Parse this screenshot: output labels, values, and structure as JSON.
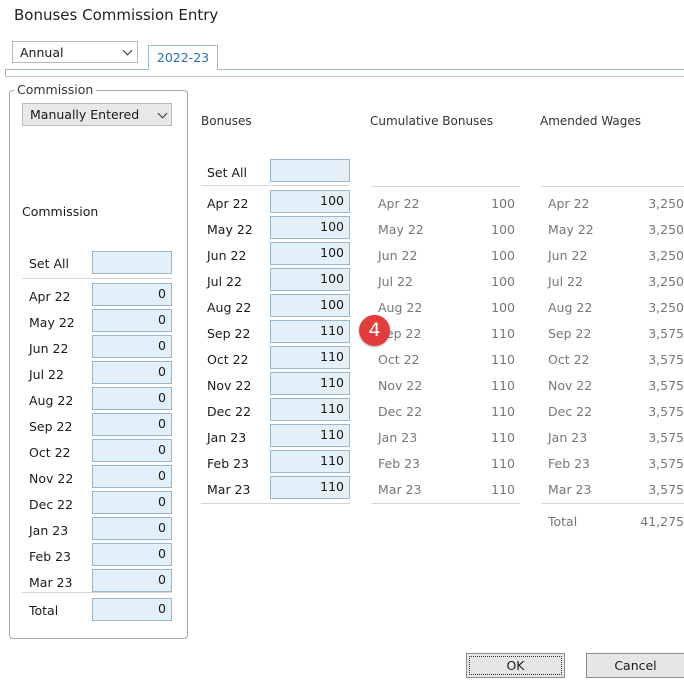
{
  "window": {
    "title": "Bonuses Commission Entry"
  },
  "period_select": {
    "value": "Annual"
  },
  "tab": {
    "label": "2022-23"
  },
  "commission": {
    "group_label": "Commission",
    "mode_select": "Manually Entered",
    "heading": "Commission",
    "set_all_label": "Set All",
    "set_all_value": "",
    "rows": [
      {
        "month": "Apr 22",
        "value": "0"
      },
      {
        "month": "May 22",
        "value": "0"
      },
      {
        "month": "Jun 22",
        "value": "0"
      },
      {
        "month": "Jul 22",
        "value": "0"
      },
      {
        "month": "Aug 22",
        "value": "0"
      },
      {
        "month": "Sep 22",
        "value": "0"
      },
      {
        "month": "Oct 22",
        "value": "0"
      },
      {
        "month": "Nov 22",
        "value": "0"
      },
      {
        "month": "Dec 22",
        "value": "0"
      },
      {
        "month": "Jan 23",
        "value": "0"
      },
      {
        "month": "Feb 23",
        "value": "0"
      },
      {
        "month": "Mar 23",
        "value": "0"
      }
    ],
    "total_label": "Total",
    "total_value": "0"
  },
  "bonuses": {
    "heading": "Bonuses",
    "set_all_label": "Set All",
    "set_all_value": "",
    "rows": [
      {
        "month": "Apr 22",
        "value": "100"
      },
      {
        "month": "May 22",
        "value": "100"
      },
      {
        "month": "Jun 22",
        "value": "100"
      },
      {
        "month": "Jul 22",
        "value": "100"
      },
      {
        "month": "Aug 22",
        "value": "100"
      },
      {
        "month": "Sep 22",
        "value": "110"
      },
      {
        "month": "Oct 22",
        "value": "110"
      },
      {
        "month": "Nov 22",
        "value": "110"
      },
      {
        "month": "Dec 22",
        "value": "110"
      },
      {
        "month": "Jan 23",
        "value": "110"
      },
      {
        "month": "Feb 23",
        "value": "110"
      },
      {
        "month": "Mar 23",
        "value": "110"
      }
    ]
  },
  "cumulative": {
    "heading": "Cumulative Bonuses",
    "rows": [
      {
        "month": "Apr 22",
        "value": "100"
      },
      {
        "month": "May 22",
        "value": "100"
      },
      {
        "month": "Jun 22",
        "value": "100"
      },
      {
        "month": "Jul 22",
        "value": "100"
      },
      {
        "month": "Aug 22",
        "value": "100"
      },
      {
        "month": "Sep 22",
        "value": "110"
      },
      {
        "month": "Oct 22",
        "value": "110"
      },
      {
        "month": "Nov 22",
        "value": "110"
      },
      {
        "month": "Dec 22",
        "value": "110"
      },
      {
        "month": "Jan 23",
        "value": "110"
      },
      {
        "month": "Feb 23",
        "value": "110"
      },
      {
        "month": "Mar 23",
        "value": "110"
      }
    ]
  },
  "amended": {
    "heading": "Amended Wages",
    "rows": [
      {
        "month": "Apr 22",
        "value": "3,250"
      },
      {
        "month": "May 22",
        "value": "3,250"
      },
      {
        "month": "Jun 22",
        "value": "3,250"
      },
      {
        "month": "Jul 22",
        "value": "3,250"
      },
      {
        "month": "Aug 22",
        "value": "3,250"
      },
      {
        "month": "Sep 22",
        "value": "3,575"
      },
      {
        "month": "Oct 22",
        "value": "3,575"
      },
      {
        "month": "Nov 22",
        "value": "3,575"
      },
      {
        "month": "Dec 22",
        "value": "3,575"
      },
      {
        "month": "Jan 23",
        "value": "3,575"
      },
      {
        "month": "Feb 23",
        "value": "3,575"
      },
      {
        "month": "Mar 23",
        "value": "3,575"
      }
    ],
    "total_label": "Total",
    "total_value": "41,275"
  },
  "callout": {
    "number": "4",
    "color": "#e33c3c"
  },
  "buttons": {
    "ok": "OK",
    "cancel": "Cancel"
  }
}
